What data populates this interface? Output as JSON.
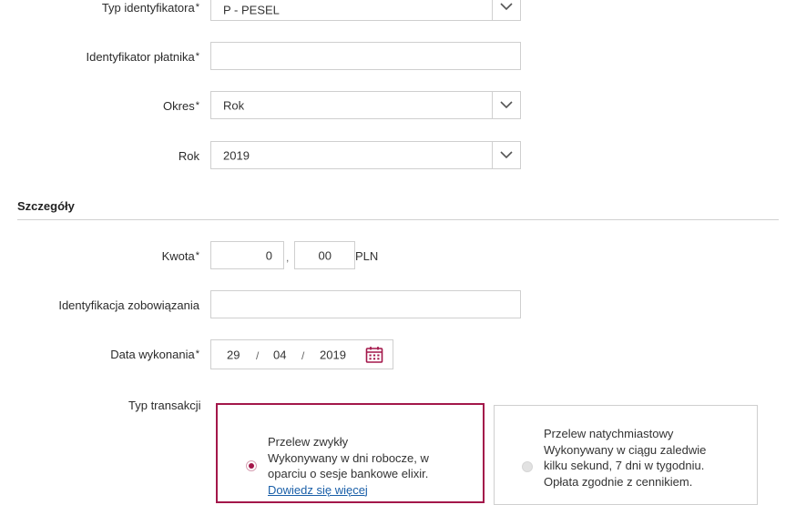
{
  "form": {
    "id_type": {
      "label": "Typ identyfikatora",
      "required_mark": "*",
      "value": "P - PESEL"
    },
    "payer_id": {
      "label": "Identyfikator płatnika",
      "required_mark": "*",
      "value": ""
    },
    "period": {
      "label": "Okres",
      "required_mark": "*",
      "value": "Rok"
    },
    "year": {
      "label": "Rok",
      "value": "2019"
    }
  },
  "details": {
    "title": "Szczegóły",
    "amount": {
      "label": "Kwota",
      "required_mark": "*",
      "integer": "0",
      "comma": ",",
      "decimal": "00",
      "currency": "PLN"
    },
    "obligation": {
      "label": "Identyfikacja zobowiązania",
      "value": ""
    },
    "date": {
      "label": "Data wykonania",
      "required_mark": "*",
      "day": "29",
      "month": "04",
      "year": "2019",
      "sep": "/"
    },
    "transaction": {
      "label": "Typ transakcji",
      "options": [
        {
          "title": "Przelew zwykły",
          "line1": "Wykonywany w dni robocze, w",
          "line2": "oparciu o sesje bankowe elixir.",
          "link": "Dowiedz się więcej",
          "selected": true
        },
        {
          "title": "Przelew natychmiastowy",
          "line1": "Wykonywany w ciągu zaledwie",
          "line2": "kilku sekund, 7 dni w tygodniu.",
          "line3": "Opłata zgodnie z cennikiem.",
          "selected": false
        }
      ]
    }
  },
  "colors": {
    "accent": "#a3174a",
    "border": "#cfcfcf",
    "link": "#1a5fa8"
  },
  "icons": {
    "dropdown": "chevron-down-icon",
    "calendar": "calendar-icon"
  }
}
